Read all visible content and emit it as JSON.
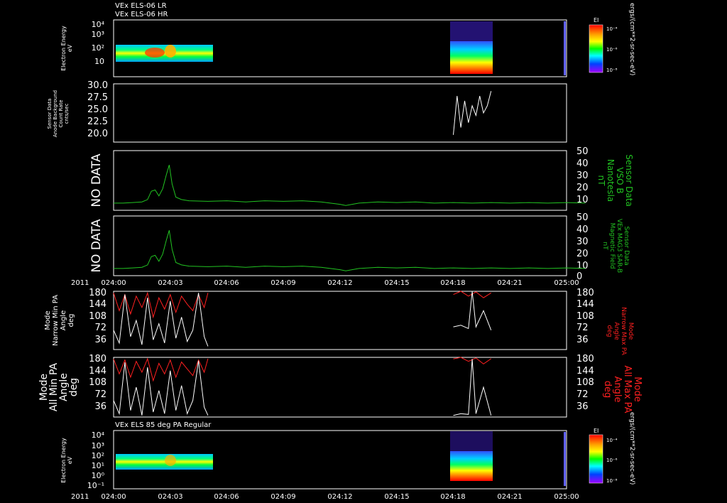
{
  "figure": {
    "top_titles": [
      "VEx ELS-06 LR",
      "VEx ELS-06 HR"
    ],
    "bottom_title": "VEx ELS 85 deg PA Regular",
    "year_label": "2011",
    "time_ticks": [
      "024:00",
      "024:03",
      "024:06",
      "024:09",
      "024:12",
      "024:15",
      "024:18",
      "024:21",
      "025:00"
    ],
    "no_data_label": "NO DATA",
    "colorbar": {
      "title": "EI",
      "tick_labels": [
        "10⁻⁴",
        "10⁻⁶",
        "10⁻⁸"
      ],
      "units": "ergs/(cm**2-sr-sec-eV)"
    },
    "colors": {
      "background": "#000000",
      "axes": "#ffffff",
      "b_field": "#22c422",
      "max_pa": "#ff2020",
      "min_pa": "#ffffff"
    }
  },
  "chart_data": [
    {
      "type": "heatmap",
      "title": "VEx ELS-06 LR / VEx ELS-06 HR",
      "ylabel": [
        "Electron Energy",
        "eV"
      ],
      "yscale": "log",
      "ytick_labels": [
        "10⁴",
        "10³",
        "10²",
        "10"
      ],
      "xrange": [
        "024:00",
        "025:00"
      ],
      "coverage": [
        [
          "024:00",
          "024:05"
        ],
        [
          "024:18",
          "024:20"
        ]
      ]
    },
    {
      "type": "line",
      "ylabel": [
        "Sensor Data",
        "Anode Background",
        "Count Rate",
        "cnts/sec"
      ],
      "ylim": [
        18,
        30
      ],
      "ytick_labels": [
        "30.0",
        "27.5",
        "25.0",
        "22.5",
        "20.0"
      ],
      "series": [
        {
          "color": "#ffffff",
          "x": [
            "024:18",
            "024:18.2",
            "024:18.4",
            "024:18.6",
            "024:18.8",
            "024:19",
            "024:19.2",
            "024:19.4",
            "024:19.6",
            "024:19.8",
            "024:20"
          ],
          "y": [
            19.5,
            27.5,
            21,
            26.5,
            22,
            25.5,
            23.5,
            27.5,
            24,
            25.5,
            28.5
          ]
        }
      ]
    },
    {
      "type": "line",
      "left_label": "NO DATA",
      "ylabel": [
        "Sensor Data",
        "VSO B",
        "Nanotesla",
        "nT"
      ],
      "ylim": [
        0,
        50
      ],
      "ytick_labels": [
        "50",
        "40",
        "30",
        "20",
        "10",
        ""
      ],
      "series": [
        {
          "color": "#22c422",
          "x": [
            0,
            0.5,
            1,
            1.5,
            1.8,
            2.0,
            2.2,
            2.4,
            2.6,
            2.8,
            2.95,
            3.1,
            3.3,
            3.6,
            4,
            5,
            6,
            7,
            8,
            9,
            10,
            11,
            12,
            12.3,
            13,
            14,
            15,
            16,
            17,
            18,
            19,
            20,
            21,
            22,
            23,
            24,
            25
          ],
          "y": [
            6,
            6,
            6.5,
            7,
            9,
            16,
            17,
            12,
            18,
            30,
            38,
            22,
            11,
            9,
            8,
            7.5,
            8,
            7,
            8,
            7.5,
            8,
            7,
            5,
            4,
            6,
            7,
            6.5,
            7,
            6,
            6.5,
            6,
            6.5,
            6,
            6.5,
            6,
            6.5,
            6
          ]
        }
      ]
    },
    {
      "type": "line",
      "left_label": "NO DATA",
      "ylabel": [
        "Sensor Data",
        "VEx MAG3 SAR-B",
        "Magnetic Field",
        "nT"
      ],
      "ylim": [
        0,
        50
      ],
      "ytick_labels": [
        "50",
        "40",
        "30",
        "20",
        "10",
        "0"
      ],
      "series": [
        {
          "color": "#22c422",
          "x": [
            0,
            0.5,
            1,
            1.5,
            1.8,
            2.0,
            2.2,
            2.4,
            2.6,
            2.8,
            2.95,
            3.1,
            3.3,
            3.6,
            4,
            5,
            6,
            7,
            8,
            9,
            10,
            11,
            12,
            12.3,
            13,
            14,
            15,
            16,
            17,
            18,
            19,
            20,
            21,
            22,
            23,
            24,
            25
          ],
          "y": [
            6,
            6,
            6.5,
            7,
            9,
            16,
            17,
            12,
            18,
            30,
            38,
            22,
            11,
            9,
            8,
            7.5,
            8,
            7,
            8,
            7.5,
            8,
            7,
            5,
            4,
            6,
            7,
            6.5,
            7,
            6,
            6.5,
            6,
            6.5,
            6,
            6.5,
            6,
            6.5,
            6
          ]
        }
      ]
    },
    {
      "type": "line",
      "ylabel": [
        "Mode",
        "Narrow Min PA",
        "Angle",
        "deg"
      ],
      "ylabel_right": [
        "Mode",
        "Narrow Max PA",
        "Angle",
        "deg"
      ],
      "ylim": [
        0,
        180
      ],
      "ytick_labels": [
        "180",
        "144",
        "108",
        "72",
        "36"
      ],
      "series": [
        {
          "color": "#ff2020",
          "x": [
            0,
            0.3,
            0.6,
            0.9,
            1.2,
            1.5,
            1.8,
            2.1,
            2.4,
            2.7,
            3.0,
            3.3,
            3.6,
            3.9,
            4.2,
            4.5,
            4.8,
            5.0,
            18,
            18.4,
            18.8,
            19.2,
            19.6,
            20.0
          ],
          "y": [
            175,
            120,
            170,
            110,
            165,
            130,
            175,
            100,
            160,
            125,
            170,
            115,
            165,
            140,
            120,
            170,
            130,
            175,
            170,
            180,
            165,
            178,
            160,
            175
          ]
        },
        {
          "color": "#ffffff",
          "x": [
            0,
            0.3,
            0.6,
            0.9,
            1.2,
            1.5,
            1.8,
            2.1,
            2.4,
            2.7,
            3.0,
            3.3,
            3.6,
            3.9,
            4.2,
            4.5,
            4.8,
            5.0,
            18,
            18.4,
            18.8,
            19.0,
            19.2,
            19.6,
            20.0
          ],
          "y": [
            60,
            20,
            170,
            40,
            90,
            15,
            160,
            30,
            80,
            20,
            150,
            35,
            100,
            25,
            60,
            175,
            40,
            10,
            70,
            75,
            65,
            180,
            70,
            120,
            60
          ]
        }
      ]
    },
    {
      "type": "line",
      "ylabel": [
        "Mode",
        "All Min PA",
        "Angle",
        "deg"
      ],
      "ylabel_right": [
        "Mode",
        "All Max PA",
        "Angle",
        "deg"
      ],
      "ylim": [
        0,
        180
      ],
      "ytick_labels": [
        "180",
        "144",
        "108",
        "72",
        "36"
      ],
      "series": [
        {
          "color": "#ff2020",
          "x": [
            0,
            0.3,
            0.6,
            0.9,
            1.2,
            1.5,
            1.8,
            2.1,
            2.4,
            2.7,
            3.0,
            3.3,
            3.6,
            3.9,
            4.2,
            4.5,
            4.8,
            5.0,
            18,
            18.4,
            18.8,
            19.2,
            19.6,
            20.0
          ],
          "y": [
            175,
            130,
            172,
            120,
            168,
            135,
            176,
            110,
            162,
            130,
            172,
            120,
            166,
            145,
            125,
            172,
            135,
            176,
            175,
            180,
            168,
            178,
            160,
            176
          ]
        },
        {
          "color": "#ffffff",
          "x": [
            0,
            0.3,
            0.6,
            0.9,
            1.2,
            1.5,
            1.8,
            2.1,
            2.4,
            2.7,
            3.0,
            3.3,
            3.6,
            3.9,
            4.2,
            4.5,
            4.8,
            5.0,
            18,
            18.4,
            18.8,
            19.0,
            19.2,
            19.6,
            20.0
          ],
          "y": [
            50,
            10,
            165,
            20,
            90,
            5,
            150,
            15,
            80,
            10,
            140,
            20,
            95,
            10,
            50,
            170,
            30,
            5,
            5,
            10,
            8,
            175,
            10,
            90,
            5
          ]
        }
      ]
    },
    {
      "type": "heatmap",
      "title": "VEx ELS 85 deg PA Regular",
      "ylabel": [
        "Electron Energy",
        "eV"
      ],
      "yscale": "log",
      "ytick_labels": [
        "10⁴",
        "10³",
        "10²",
        "10¹",
        "10⁰",
        "10⁻¹"
      ],
      "xrange": [
        "024:00",
        "025:00"
      ],
      "coverage": [
        [
          "024:00",
          "024:05"
        ],
        [
          "024:18",
          "024:20"
        ]
      ]
    }
  ]
}
